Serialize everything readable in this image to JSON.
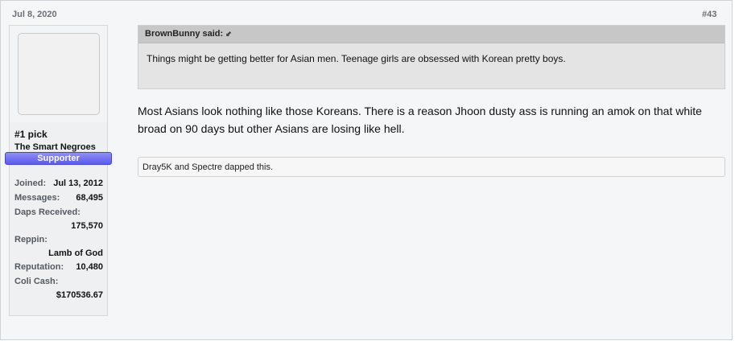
{
  "post": {
    "date": "Jul 8, 2020",
    "number": "#43"
  },
  "user": {
    "name": "#1 pick",
    "title": "The Smart Negroes",
    "banner": "Supporter",
    "stats": [
      {
        "label": "Joined:",
        "value": "Jul 13, 2012"
      },
      {
        "label": "Messages:",
        "value": "68,495"
      },
      {
        "label": "Daps Received:",
        "value": "175,570"
      },
      {
        "label": "Reppin:",
        "value": "Lamb of God"
      },
      {
        "label": "Reputation:",
        "value": "10,480"
      },
      {
        "label": "Coli Cash:",
        "value": "$170536.67"
      }
    ]
  },
  "quote": {
    "author": "BrownBunny said:",
    "arrow_icon": "quote-link-arrow",
    "text": "Things might be getting better for Asian men. Teenage girls are obsessed with Korean pretty boys."
  },
  "message": {
    "text": "Most Asians look nothing like those Koreans. There is a reason Jhoon dusty ass is running an amok on that white broad on 90 days but other Asians are losing like hell."
  },
  "likes": {
    "text": "Dray5K and Spectre dapped this."
  }
}
